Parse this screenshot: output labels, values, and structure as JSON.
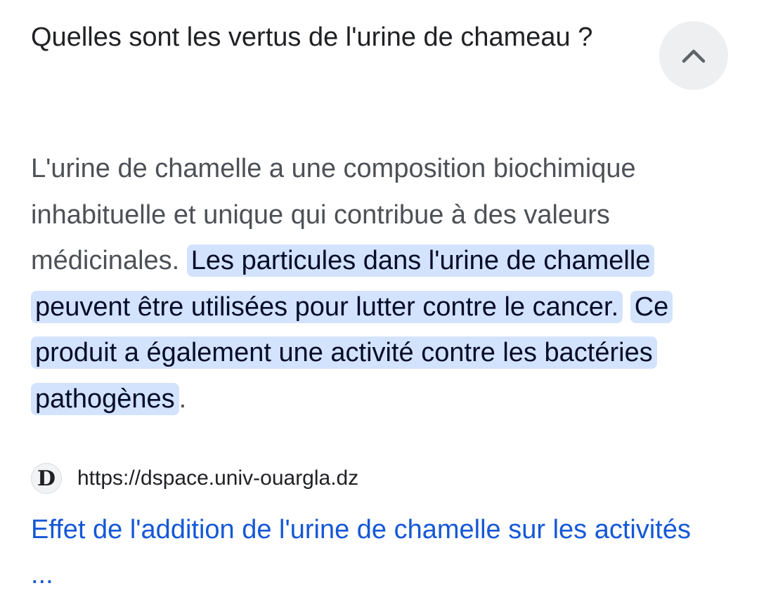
{
  "question": "Quelles sont les vertus de l'urine de chameau ?",
  "collapse_button": {
    "icon": "chevron-up-icon",
    "background": "#eeeff1"
  },
  "answer": {
    "plain_text": "L'urine de chamelle a une composition biochimique inhabituelle et unique qui contribue à des valeurs médicinales.",
    "highlight_1": "Les particules dans l'urine de chamelle peuvent être utilisées pour lutter contre le cancer.",
    "highlight_2": "Ce produit a également une activité contre les bactéries pathogènes",
    "trailing": ".",
    "highlight_color": "#d3e3fd"
  },
  "source": {
    "favicon_letter": "D",
    "url": "https://dspace.univ-ouargla.dz"
  },
  "result": {
    "title": "Effet de l'addition de l'urine de chamelle sur les activités ...",
    "link_color": "#1558d6"
  }
}
